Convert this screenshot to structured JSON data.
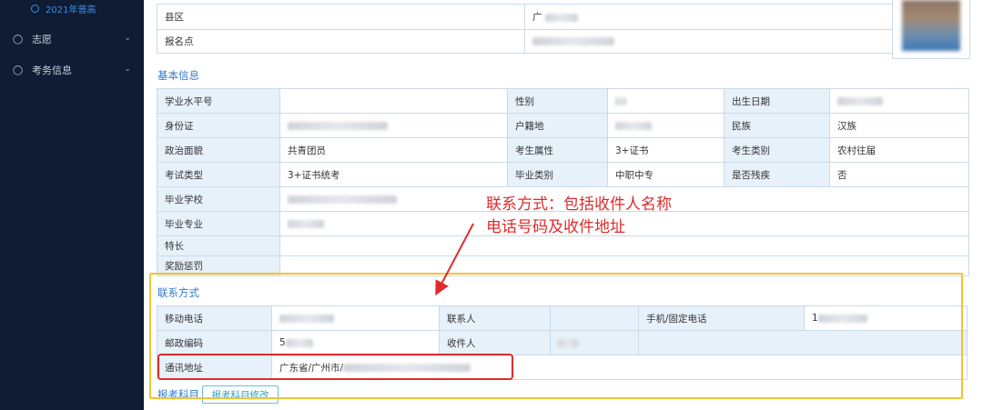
{
  "sidebar": {
    "sub_item": "2021年普高",
    "items": [
      {
        "label": "志愿",
        "icon": "people-icon"
      },
      {
        "label": "考务信息",
        "icon": "people-icon"
      }
    ]
  },
  "top_table": {
    "rows": [
      {
        "label": "县区",
        "value": "广"
      },
      {
        "label": "报名点",
        "value": ""
      }
    ]
  },
  "basic": {
    "title": "基本信息",
    "labels": {
      "xuejie": "学业水平号",
      "gender": "性别",
      "birth": "出生日期",
      "id": "身份证",
      "hukou": "户籍地",
      "nation": "民族",
      "politics": "政治面貌",
      "attr": "考生属性",
      "category": "考生类别",
      "examtype": "考试类型",
      "gradtype": "毕业类别",
      "disabled": "是否残疾",
      "school": "毕业学校",
      "major": "毕业专业",
      "specialty": "特长",
      "awards": "奖励惩罚"
    },
    "values": {
      "nation": "汉族",
      "politics": "共青团员",
      "attr": "3+证书",
      "category": "农村往届",
      "examtype": "3+证书统考",
      "gradtype": "中职中专",
      "disabled": "否"
    }
  },
  "contact": {
    "title": "联系方式",
    "labels": {
      "mobile": "移动电话",
      "contact_person": "联系人",
      "phone": "手机/固定电话",
      "postcode": "邮政编码",
      "recipient": "收件人",
      "address": "通讯地址"
    },
    "values": {
      "postcode": "5",
      "phone": "1",
      "address": "广东省/广州市/"
    }
  },
  "subjects": {
    "title": "报考科目",
    "edit_button": "报考科目修改"
  },
  "annotation": {
    "line1": "联系方式：包括收件人名称",
    "line2": "电话号码及收件地址"
  },
  "colors": {
    "highlight_yellow": "#f2c233",
    "highlight_red": "#e02b2b",
    "link_blue": "#2f7bc7",
    "sidebar_bg": "#0f1c33"
  }
}
